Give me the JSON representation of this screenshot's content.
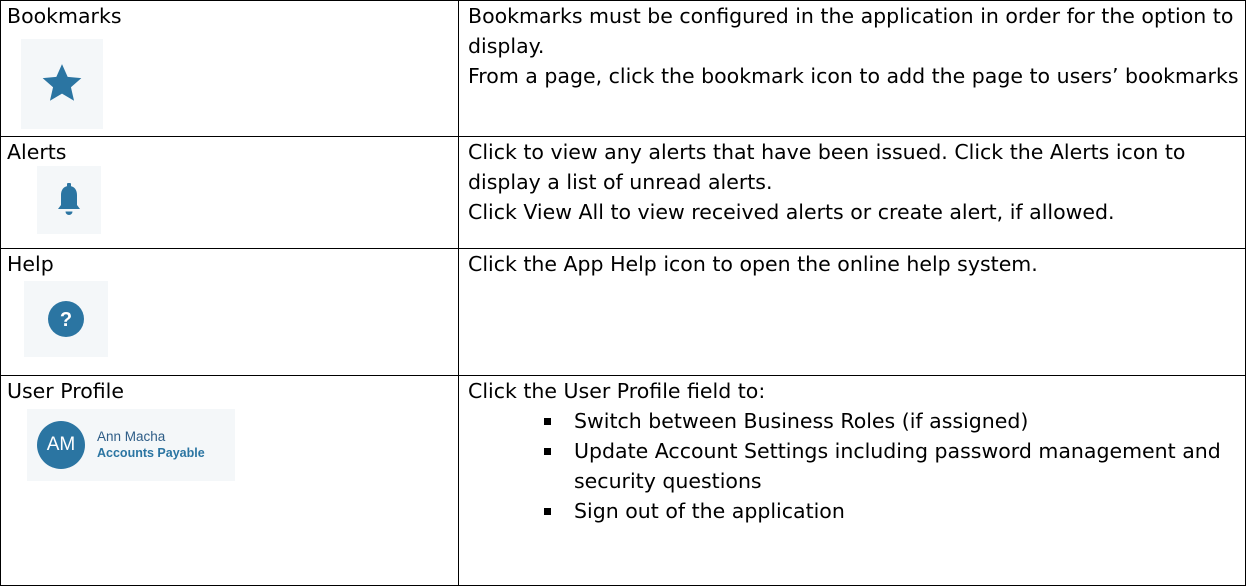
{
  "rows": [
    {
      "label": "Bookmarks",
      "icon": "star-icon",
      "description": [
        "Bookmarks must be configured in the application in order for the option to display.",
        "From a page, click the bookmark icon to add the page to users’ bookmarks"
      ]
    },
    {
      "label": "Alerts",
      "icon": "bell-icon",
      "description": [
        "Click to view any alerts that have been issued. Click the Alerts icon to display a list of unread alerts.",
        "Click View All to view received alerts or create alert, if allowed."
      ]
    },
    {
      "label": "Help",
      "icon": "help-icon",
      "description": [
        "Click the App Help icon to open the online help system."
      ]
    },
    {
      "label": "User Profile",
      "profile": {
        "initials": "AM",
        "name": "Ann Macha",
        "role": "Accounts Payable"
      },
      "intro": "Click the User Profile field to:",
      "bullets": [
        "Switch between Business Roles (if assigned)",
        "Update Account Settings including password management and security questions",
        "Sign out of the application"
      ]
    }
  ],
  "colors": {
    "icon_blue": "#2b75a2",
    "icon_background": "#f4f7f9",
    "border": "#000000"
  }
}
